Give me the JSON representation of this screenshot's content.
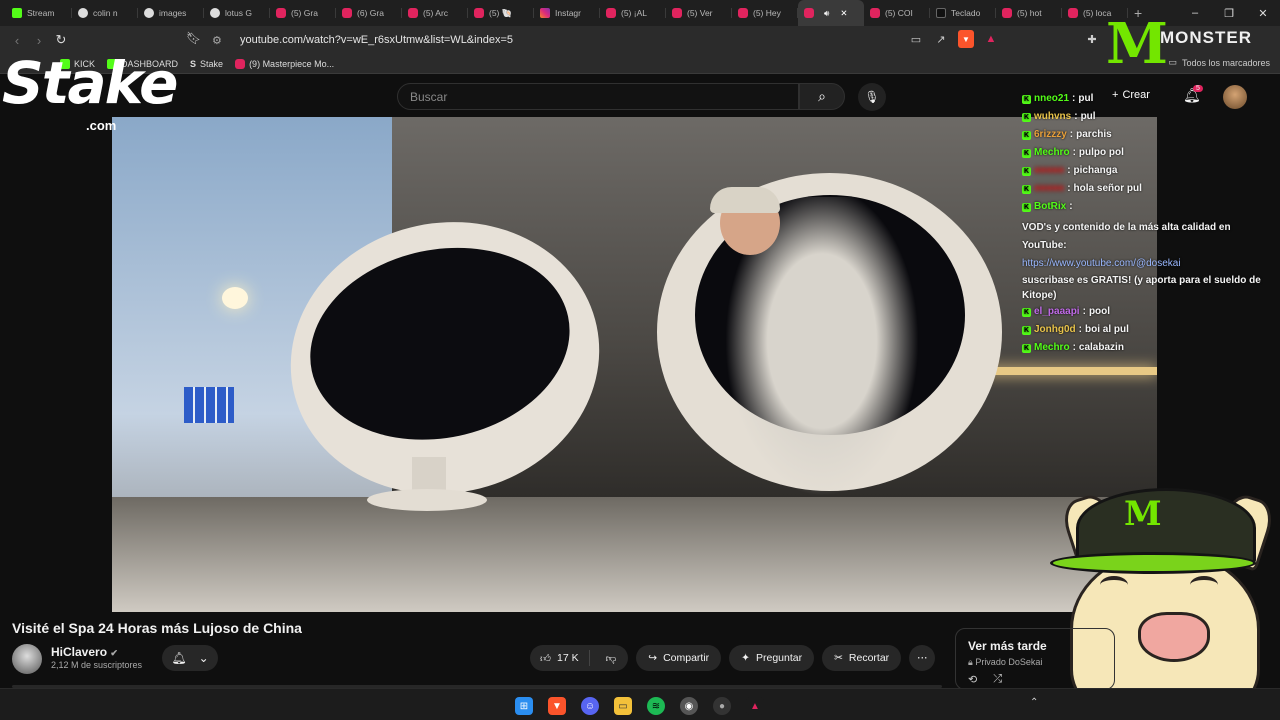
{
  "browser": {
    "tabs": [
      {
        "label": "Stream",
        "icon": "kick",
        "active": false
      },
      {
        "label": "colin n",
        "icon": "g",
        "active": false
      },
      {
        "label": "images",
        "icon": "g",
        "active": false
      },
      {
        "label": "lotus G",
        "icon": "g",
        "active": false
      },
      {
        "label": "(5) Gra",
        "icon": "yt",
        "active": false
      },
      {
        "label": "(6) Gra",
        "icon": "yt",
        "active": false
      },
      {
        "label": "(5) Arc",
        "icon": "yt",
        "active": false
      },
      {
        "label": "(5) 🐚",
        "icon": "yt",
        "active": false
      },
      {
        "label": "Instagr",
        "icon": "ig",
        "active": false
      },
      {
        "label": "(5) ¡AL",
        "icon": "yt",
        "active": false
      },
      {
        "label": "(5) Ver",
        "icon": "yt",
        "active": false
      },
      {
        "label": "(5) Hey",
        "icon": "yt",
        "active": false
      },
      {
        "label": "",
        "icon": "yt",
        "active": true
      },
      {
        "label": "(5) COI",
        "icon": "yt",
        "active": false
      },
      {
        "label": "Teclado",
        "icon": "tc",
        "active": false
      },
      {
        "label": "(5) hot",
        "icon": "yt",
        "active": false
      },
      {
        "label": "(5) loca",
        "icon": "yt",
        "active": false
      }
    ],
    "url": "youtube.com/watch?v=wE_r6sxUtmw&list=WL&index=5",
    "bookmarks": [
      {
        "label": "KICK",
        "icon": "kick"
      },
      {
        "label": "DASHBOARD",
        "icon": "kick"
      },
      {
        "label": "Stake",
        "icon": "stake"
      },
      {
        "label": "(9) Masterpiece Mo...",
        "icon": "yt"
      }
    ],
    "all_bookmarks": "Todos los marcadores"
  },
  "youtube": {
    "search_placeholder": "Buscar",
    "create_label": "Crear",
    "notif_count": "5",
    "video_title": "Visité el Spa 24 Horas más Lujoso de China",
    "channel_name": "HiClavero",
    "subscribers": "2,12 M de suscriptores",
    "likes": "17 K",
    "share_label": "Compartir",
    "ask_label": "Preguntar",
    "clip_label": "Recortar",
    "watch_later_title": "Ver más tarde",
    "watch_later_sub": "Privado DoSekai"
  },
  "overlay": {
    "stake_logo": "Stake",
    "stake_com": ".com",
    "monster_text": "MONSTER",
    "chat": [
      {
        "user": "nneo21",
        "text": "pul",
        "color": "#53fc18"
      },
      {
        "user": "wuhvns",
        "text": "pul",
        "color": "#e8c34a"
      },
      {
        "user": "6rizzzy",
        "text": "parchis",
        "color": "#e8a03a"
      },
      {
        "user": "Mechro",
        "text": "pulpo pol",
        "color": "#53fc18"
      },
      {
        "user": "",
        "text": "pichanga",
        "color": "#c02a2a"
      },
      {
        "user": "",
        "text": "hola señor pul",
        "color": "#c02a2a"
      },
      {
        "user": "BotRix",
        "text": "VOD's y contenido de la más alta calidad en YouTube:",
        "color": "#53fc18"
      },
      {
        "user": "el_paaapi",
        "text": "pool",
        "color": "#c06ae8"
      },
      {
        "user": "Jonhg0d",
        "text": "boi al pul",
        "color": "#e8c34a"
      },
      {
        "user": "Mechro",
        "text": "calabazin",
        "color": "#53fc18"
      }
    ],
    "chat_link": "https://www.youtube.com/@dosekai",
    "chat_tail": "suscribase es GRATIS! (y aporta para el sueldo de Kitope)"
  },
  "colors": {
    "accent": "#53fc18",
    "youtube_red": "#e0245e"
  }
}
